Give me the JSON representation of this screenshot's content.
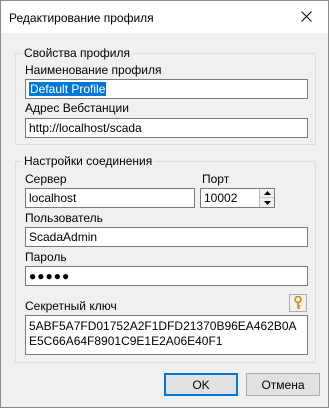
{
  "window": {
    "title": "Редактирование профиля"
  },
  "profile_group": {
    "legend": "Свойства профиля",
    "name_label": "Наименование профиля",
    "name_value": "Default Profile",
    "web_label": "Адрес Вебстанции",
    "web_value": "http://localhost/scada"
  },
  "connection_group": {
    "legend": "Настройки соединения",
    "server_label": "Сервер",
    "server_value": "localhost",
    "port_label": "Порт",
    "port_value": "10002",
    "user_label": "Пользователь",
    "user_value": "ScadaAdmin",
    "password_label": "Пароль",
    "password_value": "●●●●●",
    "key_label": "Секретный ключ",
    "key_value": "5ABF5A7FD01752A2F1DFD21370B96EA462B0AE5C66A64F8901C9E1E2A06E40F1"
  },
  "buttons": {
    "ok": "OK",
    "cancel": "Отмена"
  },
  "icons": {
    "close": "close-icon",
    "key": "key-icon",
    "spin_up": "spin-up-icon",
    "spin_down": "spin-down-icon"
  },
  "colors": {
    "selection": "#0078d7",
    "window_bg": "#f0f0f0",
    "key_icon": "#d4a017"
  }
}
